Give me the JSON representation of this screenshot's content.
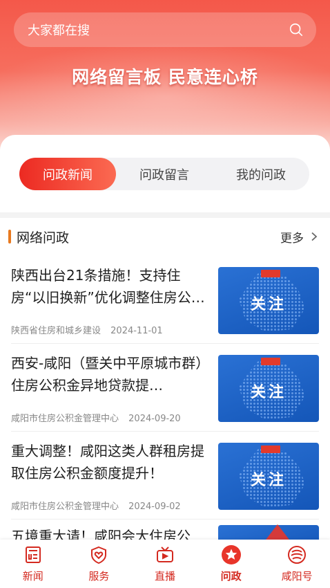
{
  "search": {
    "placeholder": "大家都在搜"
  },
  "banner": {
    "slogan": "网络留言板 民意连心桥"
  },
  "tabs": [
    {
      "label": "问政新闻",
      "active": true
    },
    {
      "label": "问政留言",
      "active": false
    },
    {
      "label": "我的问政",
      "active": false
    }
  ],
  "section": {
    "title": "网络问政",
    "more_label": "更多"
  },
  "news": [
    {
      "title": "陕西出台21条措施！支持住房“以旧换新”优化调整住房公…",
      "source": "陕西省住房和城乡建设",
      "date": "2024-11-01",
      "thumb_text": "关注"
    },
    {
      "title": "西安-咸阳（暨关中平原城市群）住房公积金异地贷款提…",
      "source": "咸阳市住房公积金管理中心",
      "date": "2024-09-20",
      "thumb_text": "关注"
    },
    {
      "title": "重大调整！咸阳这类人群租房提取住房公积金额度提升！",
      "source": "咸阳市住房公积金管理中心",
      "date": "2024-09-02",
      "thumb_text": "关注"
    }
  ],
  "partial_news": {
    "title": "五境重大请！咸阳会大住房公"
  },
  "tabbar": [
    {
      "label": "新闻",
      "icon": "newspaper-icon",
      "active": false
    },
    {
      "label": "服务",
      "icon": "shield-heart-icon",
      "active": false
    },
    {
      "label": "直播",
      "icon": "tv-icon",
      "active": false
    },
    {
      "label": "问政",
      "icon": "star-icon",
      "active": true
    },
    {
      "label": "咸阳号",
      "icon": "xianyang-logo-icon",
      "active": false
    }
  ],
  "colors": {
    "accent": "#e8352a",
    "accent_gradient_end": "#fb6a52",
    "section_bar": "#e8791f",
    "thumb_blue": "#1a5fc4"
  }
}
